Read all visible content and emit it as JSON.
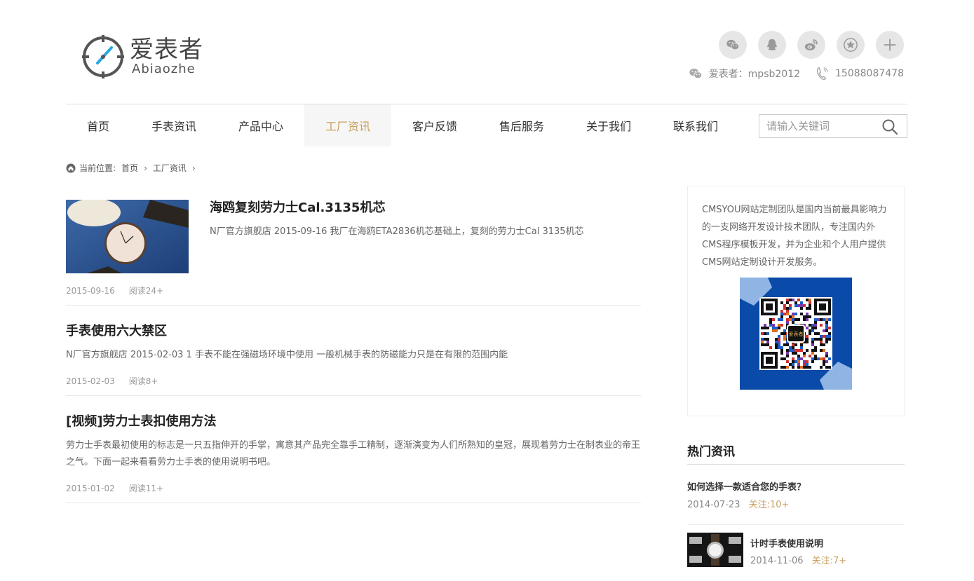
{
  "logo": {
    "name_cn": "爱表者",
    "name_en": "Abiaozhe"
  },
  "social": {
    "icons": [
      "wechat-icon",
      "qq-icon",
      "weibo-icon",
      "favorite-icon",
      "plus-icon"
    ]
  },
  "contact": {
    "wechat": "爱表者：mpsb2012",
    "phone": "15088087478"
  },
  "nav": {
    "items": [
      "首页",
      "手表资讯",
      "产品中心",
      "工厂资讯",
      "客户反馈",
      "售后服务",
      "关于我们",
      "联系我们"
    ],
    "active": "工厂资讯"
  },
  "search": {
    "placeholder": "请输入关键词"
  },
  "breadcrumb": {
    "label": "当前位置:",
    "home": "首页",
    "current": "工厂资讯"
  },
  "articles": [
    {
      "title": "海鸥复刻劳力士Cal.3135机芯",
      "desc": "N厂官方旗舰店 2015-09-16 我厂在海鸥ETA2836机芯基础上，复刻的劳力士Cal 3135机芯",
      "date": "2015-09-16",
      "reads": "阅读24+"
    },
    {
      "title": "手表使用六大禁区",
      "desc": "N厂官方旗舰店 2015-02-03 1 手表不能在强磁场环境中使用 一般机械手表的防磁能力只是在有限的范围内能",
      "date": "2015-02-03",
      "reads": "阅读8+"
    },
    {
      "title": "[视频]劳力士表扣使用方法",
      "desc": "劳力士手表最初使用的标志是一只五指伸开的手掌，寓意其产品完全靠手工精制，逐渐演变为人们所熟知的皇冠，展现着劳力士在制表业的帝王之气。下面一起来看看劳力士手表的使用说明书吧。",
      "date": "2015-01-02",
      "reads": "阅读11+"
    }
  ],
  "sidebar": {
    "about": "CMSYOU网站定制团队是国内当前最具影响力的一支网络开发设计技术团队，专注国内外CMS程序模板开发，并为企业和个人用户提供CMS网站定制设计开发服务。",
    "qr_center_text": "爱表者",
    "hot_title": "热门资讯",
    "hot": [
      {
        "title": "如何选择一款适合您的手表？",
        "date": "2014-07-23",
        "follow": "关注:10+"
      },
      {
        "title": "计时手表使用说明",
        "date": "2014-11-06",
        "follow": "关注:7+"
      }
    ]
  },
  "colors": {
    "accent": "#c8a060",
    "text": "#333333",
    "muted": "#999999",
    "qr_bg": "#0a4aa8"
  }
}
